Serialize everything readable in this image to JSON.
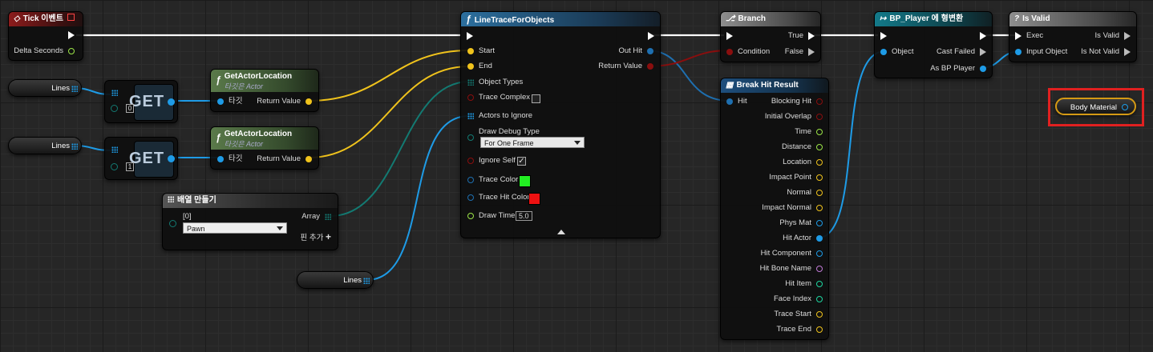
{
  "colors": {
    "exec": "#ffffff",
    "float": "#9be547",
    "vector": "#f0c31c",
    "object": "#1e9be6",
    "struct": "#1e6fb0",
    "bool": "#8a0e0e",
    "color": "#1e6fb0",
    "enum": "#137a72",
    "byte": "#137a72",
    "linecolor": "#aab",
    "highlight": "#e02020",
    "green_swatch": "#22ee22",
    "red_swatch": "#ee1111"
  },
  "tick": {
    "title": "Tick 이벤트",
    "delta_seconds": "Delta Seconds"
  },
  "vars": {
    "lines_1": "Lines",
    "lines_2": "Lines",
    "lines_3": "Lines"
  },
  "get_1": {
    "label": "GET",
    "index": "0"
  },
  "get_2": {
    "label": "GET",
    "index": "1"
  },
  "gal_1": {
    "title": "GetActorLocation",
    "subtitle": "타깃은 Actor",
    "target": "타깃",
    "return_value": "Return Value"
  },
  "gal_2": {
    "title": "GetActorLocation",
    "subtitle": "타깃은 Actor",
    "target": "타깃",
    "return_value": "Return Value"
  },
  "make_array": {
    "title": "배열 만들기",
    "index_label": "[0]",
    "option": "Pawn",
    "array": "Array",
    "add_pin": "핀 추가"
  },
  "trace": {
    "title": "LineTraceForObjects",
    "start": "Start",
    "end": "End",
    "object_types": "Object Types",
    "trace_complex": "Trace Complex",
    "actors_to_ignore": "Actors to Ignore",
    "draw_debug_type": "Draw Debug Type",
    "draw_debug_value": "For One Frame",
    "ignore_self": "Ignore Self",
    "trace_color": "Trace Color",
    "trace_hit_color": "Trace Hit Color",
    "draw_time": "Draw Time",
    "draw_time_value": "5.0",
    "out_hit": "Out Hit",
    "return_value": "Return Value"
  },
  "branch": {
    "title": "Branch",
    "condition": "Condition",
    "true_label": "True",
    "false_label": "False"
  },
  "break_hit": {
    "title": "Break Hit Result",
    "hit": "Hit",
    "outputs": [
      "Blocking Hit",
      "Initial Overlap",
      "Time",
      "Distance",
      "Location",
      "Impact Point",
      "Normal",
      "Impact Normal",
      "Phys Mat",
      "Hit Actor",
      "Hit Component",
      "Hit Bone Name",
      "Hit Item",
      "Face Index",
      "Trace Start",
      "Trace End"
    ]
  },
  "cast": {
    "title": "BP_Player 에 형변환",
    "object": "Object",
    "cast_failed": "Cast Failed",
    "as_player": "As BP Player"
  },
  "is_valid": {
    "title": "Is Valid",
    "exec": "Exec",
    "input_object": "Input Object",
    "is_valid": "Is Valid",
    "is_not_valid": "Is Not Valid"
  },
  "body_material": {
    "label": "Body Material"
  }
}
